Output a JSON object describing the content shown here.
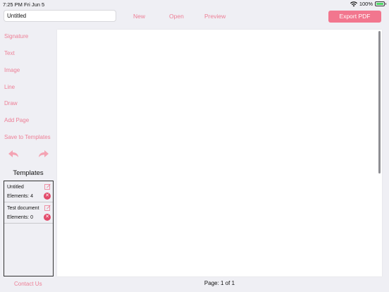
{
  "status": {
    "time": "7:25 PM",
    "date": "Fri Jun 5",
    "battery": "100%"
  },
  "header": {
    "title_value": "Untitled",
    "new_label": "New",
    "open_label": "Open",
    "preview_label": "Preview",
    "export_label": "Export PDF"
  },
  "sidebar": {
    "items": [
      "Signature",
      "Text",
      "Image",
      "Line",
      "Draw",
      "Add Page",
      "Save to Templates"
    ]
  },
  "templates": {
    "title": "Templates",
    "items": [
      {
        "name": "Untitled",
        "elements": "Elements: 4"
      },
      {
        "name": "Test document",
        "elements": "Elements: 0"
      }
    ]
  },
  "footer": {
    "contact_label": "Contact Us",
    "page_indicator": "Page: 1 of 1"
  },
  "colors": {
    "accent": "#ee7f96",
    "button": "#f2768e",
    "delete": "#e24a6a"
  }
}
